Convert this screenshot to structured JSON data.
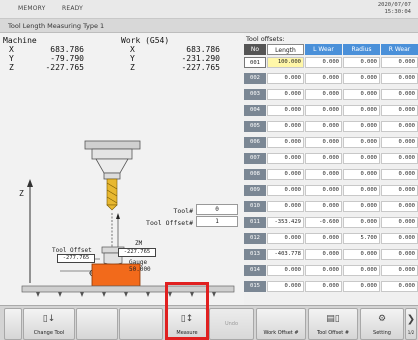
{
  "status": {
    "mode": "MEMORY",
    "state": "READY",
    "date": "2020/07/07",
    "time": "15:30:04"
  },
  "title": "Tool Length Measuring Type 1",
  "machine": {
    "label": "Machine",
    "x": "683.786",
    "y": "-79.790",
    "z": "-227.765"
  },
  "work": {
    "label": "Work (G54)",
    "x": "683.786",
    "y": "-231.290",
    "z": "-227.765"
  },
  "axes": {
    "x": "X",
    "y": "Y",
    "z": "Z"
  },
  "diagram": {
    "z_label": "Z",
    "tool_label": "Tool#",
    "tool_value": "0",
    "tool_offset_label": "Tool Offset#",
    "tool_offset_value": "1",
    "zm_label": "ZM",
    "zm_value": "-227.765",
    "offset_label": "Tool Offset",
    "offset_value": "-277.765",
    "gauge_label": "Gauge",
    "gauge_value": "50.000"
  },
  "offsets": {
    "label": "Tool offsets:",
    "headers": {
      "no": "No",
      "length": "Length",
      "lwear": "L Wear",
      "radius": "Radius",
      "rwear": "R Wear"
    },
    "rows": [
      {
        "no": "001",
        "length": "100.000",
        "lwear": "0.000",
        "radius": "0.000",
        "rwear": "0.000"
      },
      {
        "no": "002",
        "length": "0.000",
        "lwear": "0.000",
        "radius": "0.000",
        "rwear": "0.000"
      },
      {
        "no": "003",
        "length": "0.000",
        "lwear": "0.000",
        "radius": "0.000",
        "rwear": "0.000"
      },
      {
        "no": "004",
        "length": "0.000",
        "lwear": "0.000",
        "radius": "0.000",
        "rwear": "0.000"
      },
      {
        "no": "005",
        "length": "0.000",
        "lwear": "0.000",
        "radius": "0.000",
        "rwear": "0.000"
      },
      {
        "no": "006",
        "length": "0.000",
        "lwear": "0.000",
        "radius": "0.000",
        "rwear": "0.000"
      },
      {
        "no": "007",
        "length": "0.000",
        "lwear": "0.000",
        "radius": "0.000",
        "rwear": "0.000"
      },
      {
        "no": "008",
        "length": "0.000",
        "lwear": "0.000",
        "radius": "0.000",
        "rwear": "0.000"
      },
      {
        "no": "009",
        "length": "0.000",
        "lwear": "0.000",
        "radius": "0.000",
        "rwear": "0.000"
      },
      {
        "no": "010",
        "length": "0.000",
        "lwear": "0.000",
        "radius": "0.000",
        "rwear": "0.000"
      },
      {
        "no": "011",
        "length": "-353.429",
        "lwear": "-0.600",
        "radius": "0.000",
        "rwear": "0.000"
      },
      {
        "no": "012",
        "length": "0.000",
        "lwear": "0.000",
        "radius": "5.700",
        "rwear": "0.000"
      },
      {
        "no": "013",
        "length": "-403.778",
        "lwear": "0.000",
        "radius": "0.000",
        "rwear": "0.000"
      },
      {
        "no": "014",
        "length": "0.000",
        "lwear": "0.000",
        "radius": "0.000",
        "rwear": "0.000"
      },
      {
        "no": "015",
        "length": "0.000",
        "lwear": "0.000",
        "radius": "0.000",
        "rwear": "0.000"
      }
    ]
  },
  "toolbar": {
    "change_tool": "Change Tool",
    "measure": "Measure",
    "undo": "Undo",
    "work_offset": "Work Offset #",
    "tool_offset": "Tool Offset #",
    "setting": "Setting",
    "page": "1/2"
  },
  "colors": {
    "accent": "#4a90d9",
    "workpiece": "#f26a1b",
    "highlight": "#e02020"
  }
}
